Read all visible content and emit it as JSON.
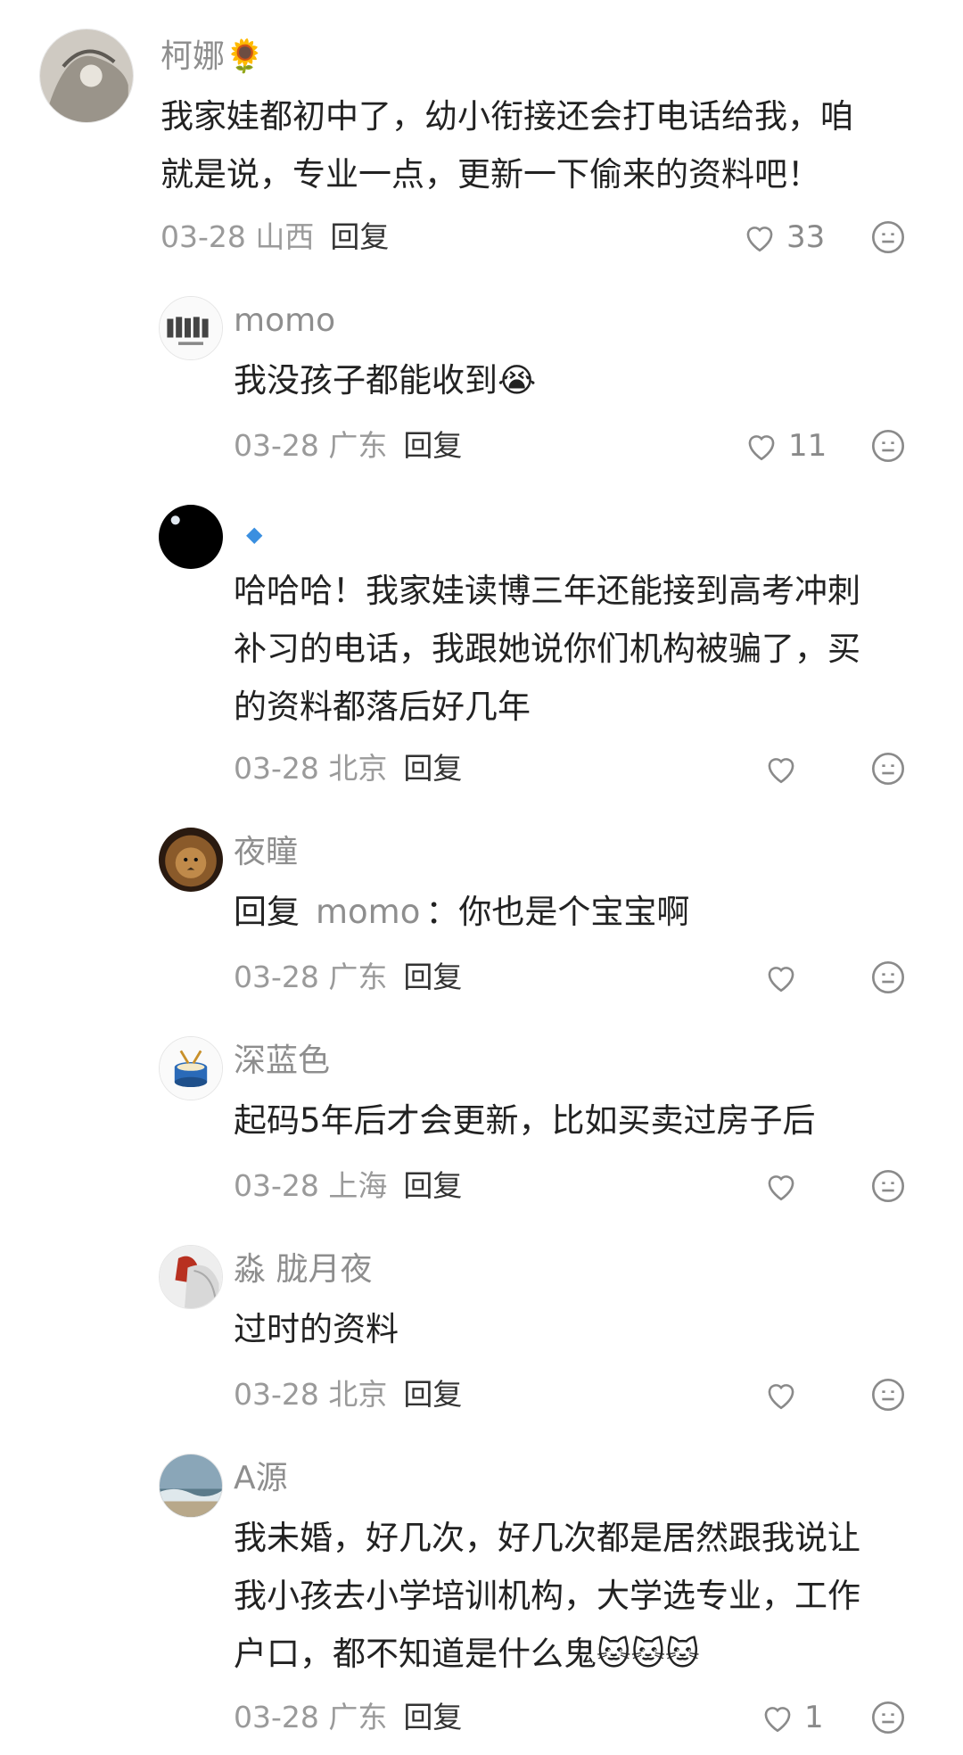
{
  "comments": [
    {
      "username": "柯娜",
      "lines": [
        "我家娃都初中了，幼小衔接还会打电话给我，咱",
        "就是说，专业一点，更新一下偷来的资料吧！"
      ],
      "date": "03-28",
      "location": "山西",
      "reply_label": "回复",
      "likes": "33"
    },
    {
      "username": "momo",
      "lines": [
        "我没孩子都能收到"
      ],
      "date": "03-28",
      "location": "广东",
      "reply_label": "回复",
      "likes": "11"
    },
    {
      "username": "",
      "lines": [
        "哈哈哈！我家娃读博三年还能接到高考冲刺",
        "补习的电话，我跟她说你们机构被骗了，买",
        "的资料都落后好几年"
      ],
      "date": "03-28",
      "location": "北京",
      "reply_label": "回复",
      "likes": ""
    },
    {
      "username": "夜瞳",
      "reply_prefix": "回复",
      "reply_to": "momo",
      "lines": [
        "：你也是个宝宝啊"
      ],
      "date": "03-28",
      "location": "广东",
      "reply_label": "回复",
      "likes": ""
    },
    {
      "username": "深蓝色",
      "lines": [
        "起码5年后才会更新，比如买卖过房子后"
      ],
      "date": "03-28",
      "location": "上海",
      "reply_label": "回复",
      "likes": ""
    },
    {
      "username": "淼 胧月夜",
      "lines": [
        "过时的资料"
      ],
      "date": "03-28",
      "location": "北京",
      "reply_label": "回复",
      "likes": ""
    },
    {
      "username": "A源",
      "lines": [
        "我未婚，好几次，好几次都是居然跟我说让",
        "我小孩去小学培训机构，大学选专业，工作",
        "户口，都不知道是什么鬼"
      ],
      "date": "03-28",
      "location": "广东",
      "reply_label": "回复",
      "likes": "1"
    }
  ]
}
